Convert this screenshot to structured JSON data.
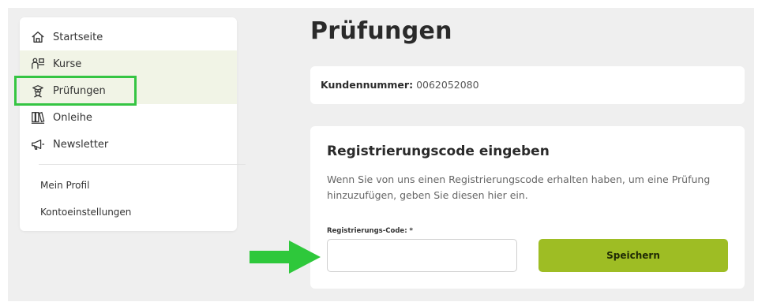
{
  "sidebar": {
    "items": [
      {
        "label": "Startseite",
        "icon": "home-icon"
      },
      {
        "label": "Kurse",
        "icon": "kurse-icon"
      },
      {
        "label": "Prüfungen",
        "icon": "exam-icon"
      },
      {
        "label": "Onleihe",
        "icon": "books-icon"
      },
      {
        "label": "Newsletter",
        "icon": "megaphone-icon"
      }
    ],
    "links": [
      "Mein Profil",
      "Kontoeinstellungen"
    ]
  },
  "main": {
    "title": "Prüfungen",
    "customer": {
      "label": "Kundennummer:",
      "value": "0062052080"
    },
    "registration": {
      "heading": "Registrierungscode eingeben",
      "description": "Wenn Sie von uns einen Registrierungscode erhalten haben, um eine Prüfung hinzuzufügen, geben Sie diesen hier ein.",
      "field_label": "Registrierungs-Code: *",
      "field_value": "",
      "save_label": "Speichern"
    }
  },
  "colors": {
    "background": "#efefef",
    "accent": "#9ebd24",
    "highlight": "#35c543",
    "arrow": "#2ec83b",
    "active_tint": "#f1f4e6"
  }
}
